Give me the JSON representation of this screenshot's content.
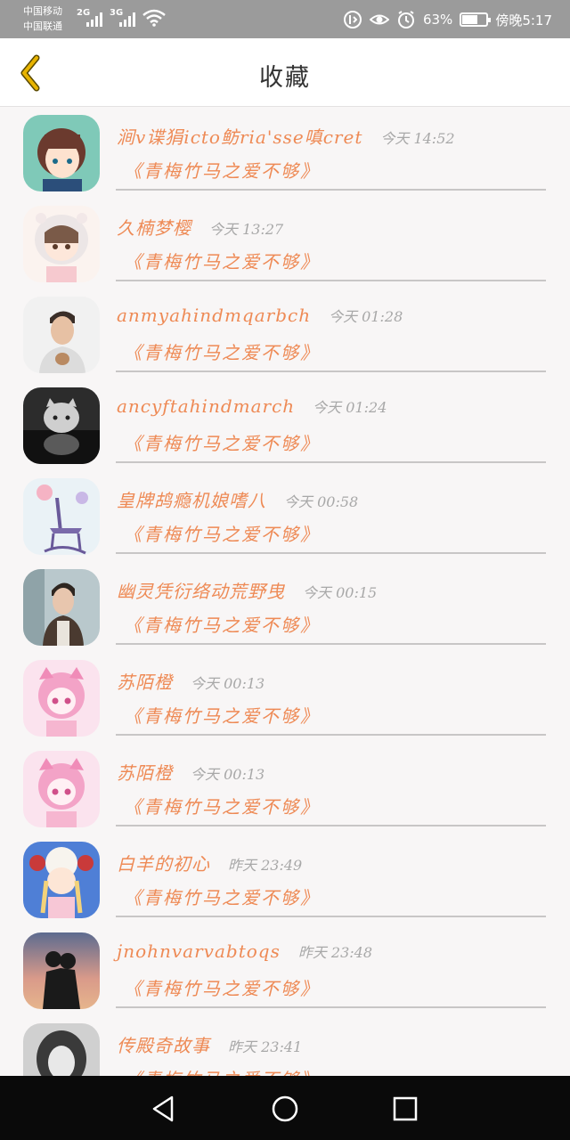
{
  "status_bar": {
    "carrier_1": "中国移动",
    "carrier_2": "中国联通",
    "network_1": "2G",
    "network_2": "3G",
    "battery_percent": "63%",
    "battery_level": 0.63,
    "time": "傍晚5:17"
  },
  "header": {
    "title": "收藏"
  },
  "items": [
    {
      "name": "涧v谍狷icto鲂ria'sse嗔cret",
      "time": "今天 14:52",
      "title": "《青梅竹马之爱不够》"
    },
    {
      "name": "久楠梦樱",
      "time": "今天 13:27",
      "title": "《青梅竹马之爱不够》"
    },
    {
      "name": "anmyahindmqarbch",
      "time": "今天 01:28",
      "title": "《青梅竹马之爱不够》"
    },
    {
      "name": "ancyftahindmarch",
      "time": "今天 01:24",
      "title": "《青梅竹马之爱不够》"
    },
    {
      "name": "皇牌鸪瘾机娘嗜八",
      "time": "今天 00:58",
      "title": "《青梅竹马之爱不够》"
    },
    {
      "name": "幽灵凭衍络动荒野曳",
      "time": "今天 00:15",
      "title": "《青梅竹马之爱不够》"
    },
    {
      "name": "苏陌橙",
      "time": "今天 00:13",
      "title": "《青梅竹马之爱不够》"
    },
    {
      "name": "苏陌橙",
      "time": "今天 00:13",
      "title": "《青梅竹马之爱不够》"
    },
    {
      "name": "白羊的初心",
      "time": "昨天 23:49",
      "title": "《青梅竹马之爱不够》"
    },
    {
      "name": "jnohnvarvabtoqs",
      "time": "昨天 23:48",
      "title": "《青梅竹马之爱不够》"
    },
    {
      "name": "传殿奇故事",
      "time": "昨天 23:41",
      "title": "《青梅竹马之爱不够》"
    }
  ],
  "colors": {
    "accent": "#ee8a55",
    "back_icon": "#e8b400",
    "status_bar": "#9b9b9b",
    "nav_bar": "#0a0a0a"
  },
  "icons": {
    "back": "chevron-left-icon",
    "nav_back": "triangle-back-icon",
    "nav_home": "circle-home-icon",
    "nav_recent": "square-recent-icon"
  }
}
